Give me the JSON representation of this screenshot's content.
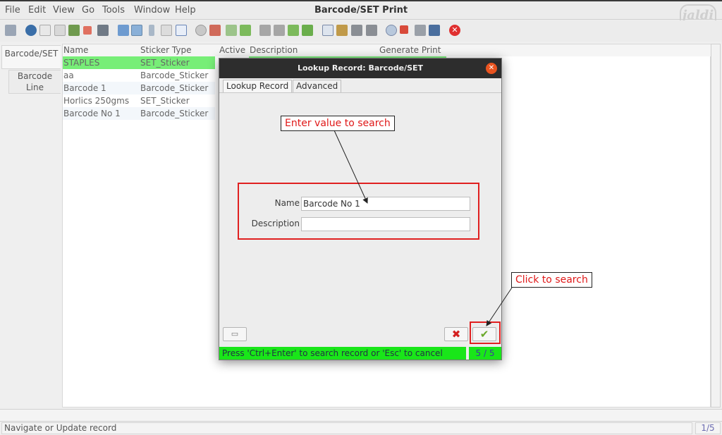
{
  "menubar": {
    "items": [
      {
        "label": "File",
        "ul": "F"
      },
      {
        "label": "Edit",
        "ul": "E"
      },
      {
        "label": "View",
        "ul": "V"
      },
      {
        "label": "Go",
        "ul": "G"
      },
      {
        "label": "Tools",
        "ul": "T"
      },
      {
        "label": "Window",
        "ul": ""
      },
      {
        "label": "Help",
        "ul": "H"
      }
    ],
    "title": "Barcode/SET Print",
    "logo_text": "jaldi"
  },
  "toolbar": {
    "icons": [
      "undo-icon",
      "help-icon",
      "new-icon",
      "copy-icon",
      "save-icon",
      "delete-icon",
      "grid-icon",
      "refresh-icon",
      "find-icon",
      "attachment-icon",
      "chat-icon",
      "zoom-icon",
      "history-icon",
      "home-icon",
      "prev-icon",
      "next-icon",
      "first-icon",
      "up-icon",
      "down-icon",
      "last-icon",
      "report-icon",
      "archive-icon",
      "print-icon",
      "print-preview-icon",
      "zoom-across-icon",
      "workflow-icon",
      "request-icon",
      "product-icon",
      "close-icon"
    ]
  },
  "left_tabs": [
    {
      "label": "Barcode/SET"
    },
    {
      "label1": "Barcode",
      "label2": "Line"
    }
  ],
  "grid": {
    "columns": [
      "Name",
      "Sticker Type",
      "Active",
      "Description",
      "Generate Print"
    ],
    "rows": [
      {
        "name": "STAPLES",
        "type": "SET_Sticker"
      },
      {
        "name": "aa",
        "type": "Barcode_Sticker"
      },
      {
        "name": "Barcode 1",
        "type": "Barcode_Sticker"
      },
      {
        "name": "Horlics 250gms",
        "type": "SET_Sticker"
      },
      {
        "name": "Barcode No 1",
        "type": "Barcode_Sticker"
      }
    ]
  },
  "dialog": {
    "title": "Lookup Record: Barcode/SET",
    "tab_lookup": "Lookup Record",
    "tab_lookup_ul": "L",
    "tab_advanced": "Advanced",
    "tab_advanced_ul": "A",
    "name_label": "Name",
    "name_value": "Barcode No 1",
    "description_label": "Description",
    "description_value": "",
    "status_text": "Press 'Ctrl+Enter' to search record or 'Esc' to cancel",
    "count_text": "5 / 5"
  },
  "callouts": {
    "enter_value": "Enter value to search",
    "click_search": "Click to search"
  },
  "status": {
    "text": "Navigate or Update record",
    "count": "1/5"
  },
  "colors": {
    "selected_row": "#77ee77",
    "status_green": "#19e619",
    "annotation_red": "#e02020",
    "dialog_title_bg": "#2d2d2d",
    "close_orange": "#e95420"
  }
}
